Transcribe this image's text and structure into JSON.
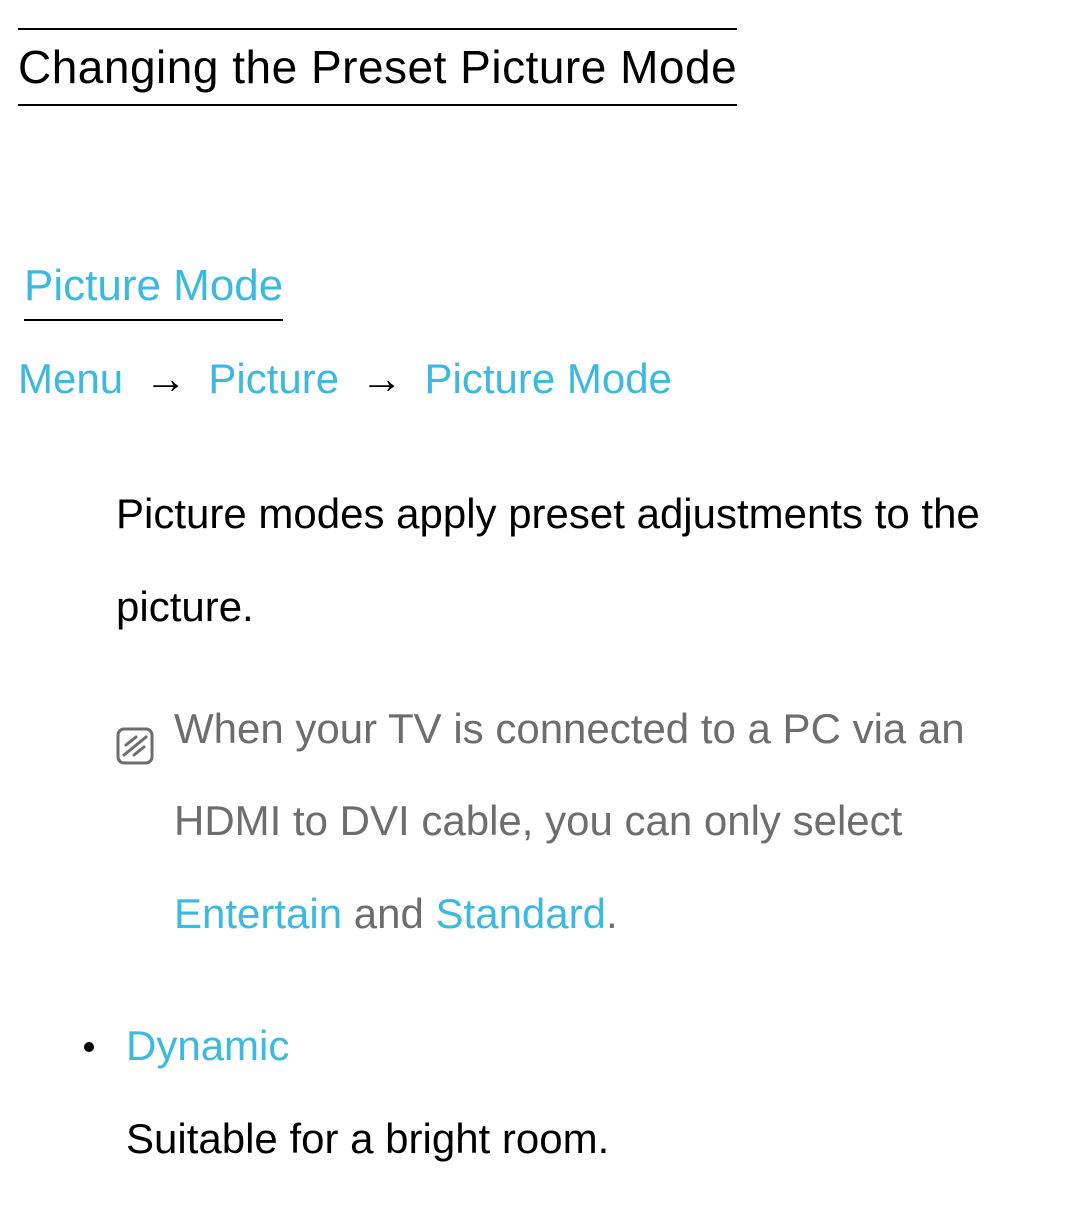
{
  "title": "Changing the Preset Picture Mode",
  "section_link": "Picture Mode",
  "breadcrumb": {
    "step1": "Menu",
    "arrow": "→",
    "step2": "Picture",
    "step3": "Picture Mode"
  },
  "description": "Picture modes apply preset adjustments to the picture.",
  "note": {
    "prefix": "When your TV is connected to a PC via an HDMI to DVI cable, you can only select ",
    "hl1": "Entertain",
    "mid": " and ",
    "hl2": "Standard",
    "suffix": "."
  },
  "list": {
    "item1": {
      "title": "Dynamic",
      "desc": "Suitable for a bright room."
    }
  }
}
